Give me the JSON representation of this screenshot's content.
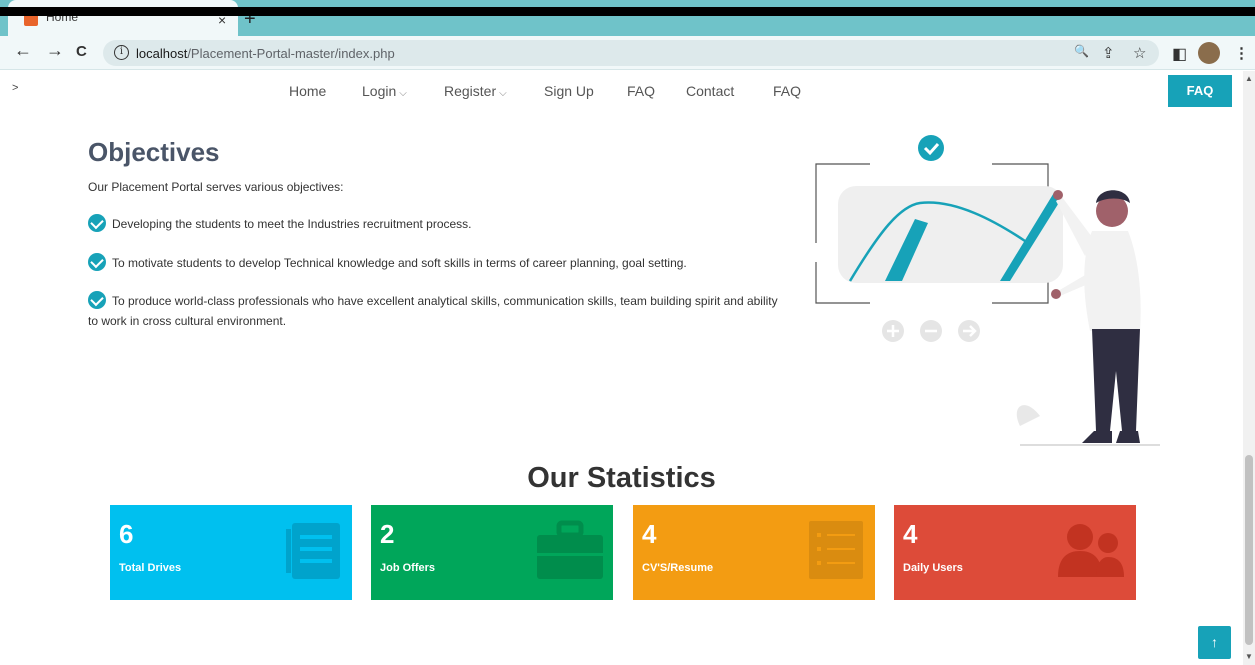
{
  "browser": {
    "tab_title": "Home",
    "tab_close": "×",
    "new_tab": "+",
    "back": "←",
    "forward": "→",
    "reload": "C",
    "info": "i",
    "url_host": "localhost",
    "url_path": "/Placement-Portal-master/index.php",
    "zoom_icon": "🔍",
    "share_icon": "⇪",
    "star_icon": "☆",
    "panel_icon": "◧",
    "menu_icon": "⋮"
  },
  "nav": {
    "toggle": ">",
    "items": [
      "Home",
      "Login",
      "Register",
      "Sign Up",
      "FAQ",
      "Contact",
      "FAQ"
    ],
    "caret": "⌵",
    "faq_button": "FAQ"
  },
  "objectives": {
    "title": "Objectives",
    "subtitle": "Our Placement Portal serves various objectives:",
    "items": [
      "Developing the students to meet the Industries recruitment process.",
      "To motivate students to develop Technical knowledge and soft skills in terms of career planning, goal setting.",
      "To produce world-class professionals who have excellent analytical skills, communication skills, team building spirit and ability to work in cross cultural environment."
    ]
  },
  "stats": {
    "title": "Our Statistics",
    "cards": [
      {
        "value": "6",
        "label": "Total Drives",
        "color": "#00c0ef",
        "icon": "list-icon"
      },
      {
        "value": "2",
        "label": "Job Offers",
        "color": "#00a65a",
        "icon": "briefcase-icon"
      },
      {
        "value": "4",
        "label": "CV'S/Resume",
        "color": "#f39c12",
        "icon": "document-icon"
      },
      {
        "value": "4",
        "label": "Daily Users",
        "color": "#dd4b39",
        "icon": "users-icon"
      }
    ]
  },
  "back_to_top": "↑",
  "colors": {
    "accent": "#17a2b8"
  }
}
